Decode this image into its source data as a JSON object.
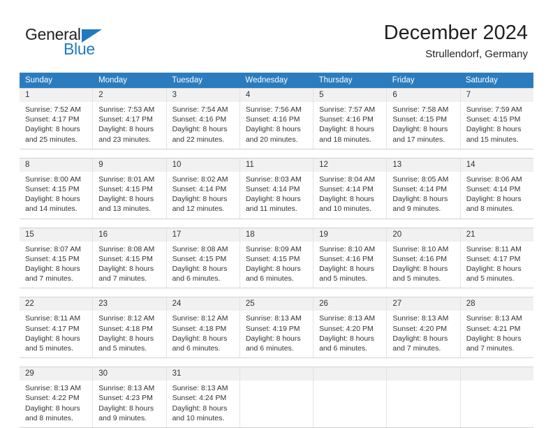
{
  "logo": {
    "word_one": "General",
    "word_two": "Blue",
    "triangle": "blue-triangle-icon",
    "brand_color": "#1f7ac0"
  },
  "header": {
    "title": "December 2024",
    "subtitle": "Strullendorf, Germany"
  },
  "calendar": {
    "header_bg": "#2b7cbf",
    "daynum_bg": "#f1f1f1",
    "weekday_labels": [
      "Sunday",
      "Monday",
      "Tuesday",
      "Wednesday",
      "Thursday",
      "Friday",
      "Saturday"
    ],
    "weeks": [
      [
        {
          "day": "1",
          "sunrise": "Sunrise: 7:52 AM",
          "sunset": "Sunset: 4:17 PM",
          "daylight_1": "Daylight: 8 hours",
          "daylight_2": "and 25 minutes."
        },
        {
          "day": "2",
          "sunrise": "Sunrise: 7:53 AM",
          "sunset": "Sunset: 4:17 PM",
          "daylight_1": "Daylight: 8 hours",
          "daylight_2": "and 23 minutes."
        },
        {
          "day": "3",
          "sunrise": "Sunrise: 7:54 AM",
          "sunset": "Sunset: 4:16 PM",
          "daylight_1": "Daylight: 8 hours",
          "daylight_2": "and 22 minutes."
        },
        {
          "day": "4",
          "sunrise": "Sunrise: 7:56 AM",
          "sunset": "Sunset: 4:16 PM",
          "daylight_1": "Daylight: 8 hours",
          "daylight_2": "and 20 minutes."
        },
        {
          "day": "5",
          "sunrise": "Sunrise: 7:57 AM",
          "sunset": "Sunset: 4:16 PM",
          "daylight_1": "Daylight: 8 hours",
          "daylight_2": "and 18 minutes."
        },
        {
          "day": "6",
          "sunrise": "Sunrise: 7:58 AM",
          "sunset": "Sunset: 4:15 PM",
          "daylight_1": "Daylight: 8 hours",
          "daylight_2": "and 17 minutes."
        },
        {
          "day": "7",
          "sunrise": "Sunrise: 7:59 AM",
          "sunset": "Sunset: 4:15 PM",
          "daylight_1": "Daylight: 8 hours",
          "daylight_2": "and 15 minutes."
        }
      ],
      [
        {
          "day": "8",
          "sunrise": "Sunrise: 8:00 AM",
          "sunset": "Sunset: 4:15 PM",
          "daylight_1": "Daylight: 8 hours",
          "daylight_2": "and 14 minutes."
        },
        {
          "day": "9",
          "sunrise": "Sunrise: 8:01 AM",
          "sunset": "Sunset: 4:15 PM",
          "daylight_1": "Daylight: 8 hours",
          "daylight_2": "and 13 minutes."
        },
        {
          "day": "10",
          "sunrise": "Sunrise: 8:02 AM",
          "sunset": "Sunset: 4:14 PM",
          "daylight_1": "Daylight: 8 hours",
          "daylight_2": "and 12 minutes."
        },
        {
          "day": "11",
          "sunrise": "Sunrise: 8:03 AM",
          "sunset": "Sunset: 4:14 PM",
          "daylight_1": "Daylight: 8 hours",
          "daylight_2": "and 11 minutes."
        },
        {
          "day": "12",
          "sunrise": "Sunrise: 8:04 AM",
          "sunset": "Sunset: 4:14 PM",
          "daylight_1": "Daylight: 8 hours",
          "daylight_2": "and 10 minutes."
        },
        {
          "day": "13",
          "sunrise": "Sunrise: 8:05 AM",
          "sunset": "Sunset: 4:14 PM",
          "daylight_1": "Daylight: 8 hours",
          "daylight_2": "and 9 minutes."
        },
        {
          "day": "14",
          "sunrise": "Sunrise: 8:06 AM",
          "sunset": "Sunset: 4:14 PM",
          "daylight_1": "Daylight: 8 hours",
          "daylight_2": "and 8 minutes."
        }
      ],
      [
        {
          "day": "15",
          "sunrise": "Sunrise: 8:07 AM",
          "sunset": "Sunset: 4:15 PM",
          "daylight_1": "Daylight: 8 hours",
          "daylight_2": "and 7 minutes."
        },
        {
          "day": "16",
          "sunrise": "Sunrise: 8:08 AM",
          "sunset": "Sunset: 4:15 PM",
          "daylight_1": "Daylight: 8 hours",
          "daylight_2": "and 7 minutes."
        },
        {
          "day": "17",
          "sunrise": "Sunrise: 8:08 AM",
          "sunset": "Sunset: 4:15 PM",
          "daylight_1": "Daylight: 8 hours",
          "daylight_2": "and 6 minutes."
        },
        {
          "day": "18",
          "sunrise": "Sunrise: 8:09 AM",
          "sunset": "Sunset: 4:15 PM",
          "daylight_1": "Daylight: 8 hours",
          "daylight_2": "and 6 minutes."
        },
        {
          "day": "19",
          "sunrise": "Sunrise: 8:10 AM",
          "sunset": "Sunset: 4:16 PM",
          "daylight_1": "Daylight: 8 hours",
          "daylight_2": "and 5 minutes."
        },
        {
          "day": "20",
          "sunrise": "Sunrise: 8:10 AM",
          "sunset": "Sunset: 4:16 PM",
          "daylight_1": "Daylight: 8 hours",
          "daylight_2": "and 5 minutes."
        },
        {
          "day": "21",
          "sunrise": "Sunrise: 8:11 AM",
          "sunset": "Sunset: 4:17 PM",
          "daylight_1": "Daylight: 8 hours",
          "daylight_2": "and 5 minutes."
        }
      ],
      [
        {
          "day": "22",
          "sunrise": "Sunrise: 8:11 AM",
          "sunset": "Sunset: 4:17 PM",
          "daylight_1": "Daylight: 8 hours",
          "daylight_2": "and 5 minutes."
        },
        {
          "day": "23",
          "sunrise": "Sunrise: 8:12 AM",
          "sunset": "Sunset: 4:18 PM",
          "daylight_1": "Daylight: 8 hours",
          "daylight_2": "and 5 minutes."
        },
        {
          "day": "24",
          "sunrise": "Sunrise: 8:12 AM",
          "sunset": "Sunset: 4:18 PM",
          "daylight_1": "Daylight: 8 hours",
          "daylight_2": "and 6 minutes."
        },
        {
          "day": "25",
          "sunrise": "Sunrise: 8:13 AM",
          "sunset": "Sunset: 4:19 PM",
          "daylight_1": "Daylight: 8 hours",
          "daylight_2": "and 6 minutes."
        },
        {
          "day": "26",
          "sunrise": "Sunrise: 8:13 AM",
          "sunset": "Sunset: 4:20 PM",
          "daylight_1": "Daylight: 8 hours",
          "daylight_2": "and 6 minutes."
        },
        {
          "day": "27",
          "sunrise": "Sunrise: 8:13 AM",
          "sunset": "Sunset: 4:20 PM",
          "daylight_1": "Daylight: 8 hours",
          "daylight_2": "and 7 minutes."
        },
        {
          "day": "28",
          "sunrise": "Sunrise: 8:13 AM",
          "sunset": "Sunset: 4:21 PM",
          "daylight_1": "Daylight: 8 hours",
          "daylight_2": "and 7 minutes."
        }
      ],
      [
        {
          "day": "29",
          "sunrise": "Sunrise: 8:13 AM",
          "sunset": "Sunset: 4:22 PM",
          "daylight_1": "Daylight: 8 hours",
          "daylight_2": "and 8 minutes."
        },
        {
          "day": "30",
          "sunrise": "Sunrise: 8:13 AM",
          "sunset": "Sunset: 4:23 PM",
          "daylight_1": "Daylight: 8 hours",
          "daylight_2": "and 9 minutes."
        },
        {
          "day": "31",
          "sunrise": "Sunrise: 8:13 AM",
          "sunset": "Sunset: 4:24 PM",
          "daylight_1": "Daylight: 8 hours",
          "daylight_2": "and 10 minutes."
        },
        {
          "day": "",
          "sunrise": "",
          "sunset": "",
          "daylight_1": "",
          "daylight_2": ""
        },
        {
          "day": "",
          "sunrise": "",
          "sunset": "",
          "daylight_1": "",
          "daylight_2": ""
        },
        {
          "day": "",
          "sunrise": "",
          "sunset": "",
          "daylight_1": "",
          "daylight_2": ""
        },
        {
          "day": "",
          "sunrise": "",
          "sunset": "",
          "daylight_1": "",
          "daylight_2": ""
        }
      ]
    ]
  }
}
